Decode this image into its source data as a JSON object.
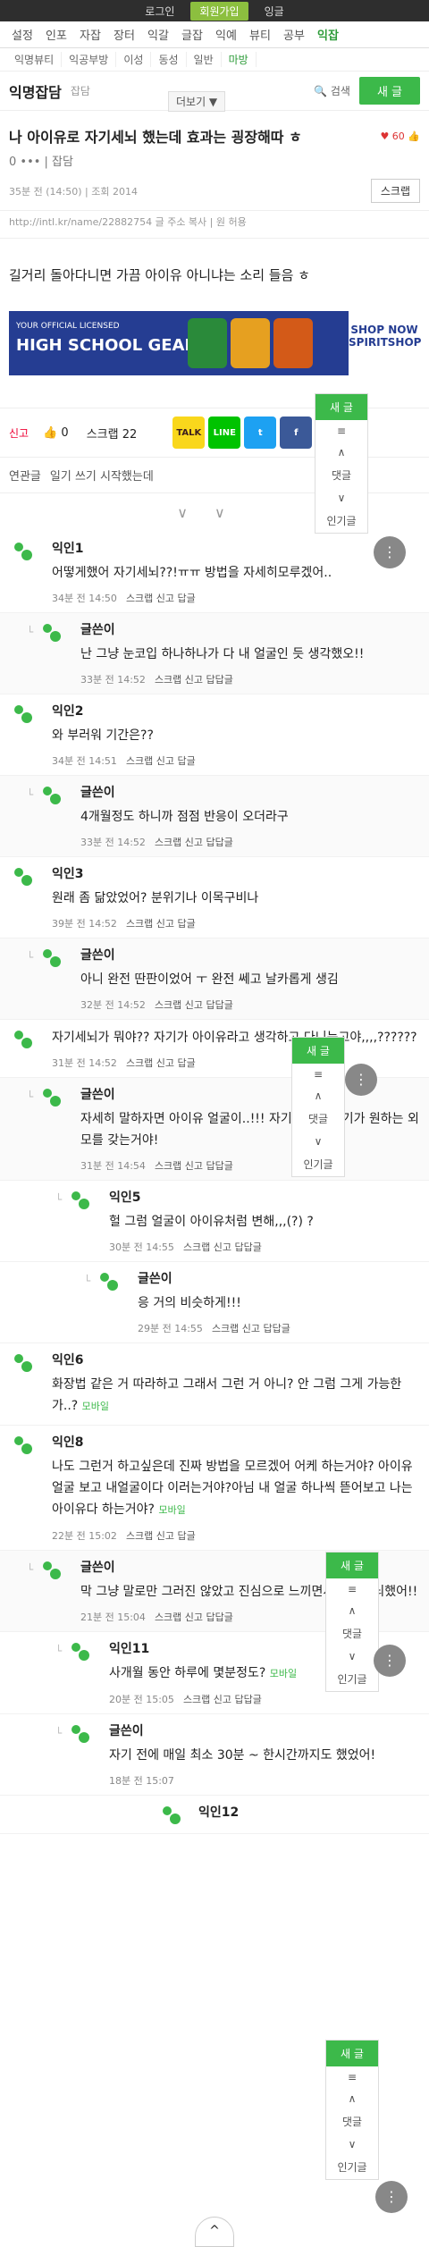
{
  "topbar": {
    "login": "로그인",
    "join": "회원가입",
    "english": "잉글"
  },
  "categories": [
    "설정",
    "인포",
    "자잡",
    "장터",
    "익갈",
    "글잡",
    "익예",
    "뷰티",
    "공부",
    "익잡"
  ],
  "subcategories": [
    "익명뷰티",
    "익공부방",
    "이성",
    "동성",
    "일반",
    "마방"
  ],
  "board": {
    "name": "익명잡담",
    "sub": "잡담",
    "more": "더보기 ▼",
    "search": "검색",
    "write": "새 글"
  },
  "post": {
    "title": "나 아이유로 자기세뇌 했는데 효과는 굉장해따 ㅎ",
    "rec_count": "60",
    "meta1": "0 ••• | 잡담",
    "meta2": "35분 전 (14:50) | 조회 2014",
    "scrap": "스크랩",
    "url": "http://intl.kr/name/22882754 글 주소 복사 | 원 허용",
    "body": "길거리 돌아다니면 가끔 아이유 아니냐는 소리 들음 ㅎ"
  },
  "ad": {
    "line1": "YOUR OFFICIAL LICENSED",
    "line2": "HIGH SCHOOL GEAR",
    "shop": "SHOP NOW SPIRITSHOP"
  },
  "actions": {
    "report": "신고",
    "like": "0",
    "scrap": "스크랩 22",
    "talk": "TALK",
    "line": "LINE",
    "twitter": "t",
    "facebook": "f"
  },
  "related": {
    "label": "연관글",
    "item": "일기 쓰기 시작했는데"
  },
  "floating": {
    "new": "새 글",
    "list": "≡",
    "up": "∧",
    "comments": "댓글",
    "down": "∨",
    "popular": "인기글"
  },
  "comments": [
    {
      "nick": "익인1",
      "text": "어떻게했어 자기세뇌??!ㅠㅠ 방법을 자세히모루겠어..",
      "meta": "34분 전 14:50",
      "links": "스크랩 신고 답글"
    },
    {
      "nick": "글쓴이",
      "text": "난 그냥 눈코입 하나하나가 다 내 얼굴인 듯 생각했오!!",
      "meta": "33분 전 14:52",
      "links": "스크랩 신고 답답글"
    },
    {
      "nick": "익인2",
      "text": "와 부러워 기간은??",
      "meta": "34분 전 14:51",
      "links": "스크랩 신고 답글"
    },
    {
      "nick": "글쓴이",
      "text": "4개월정도 하니까 점점 반응이 오더라구",
      "meta": "33분 전 14:52",
      "links": "스크랩 신고 답답글"
    },
    {
      "nick": "익인3",
      "text": "원래 좀 닮았었어? 분위기나 이목구비나",
      "meta": "39분 전 14:52",
      "links": "스크랩 신고 답글"
    },
    {
      "nick": "글쓴이",
      "text": "아니 완전 딴판이었어 ㅜ 완전 쎄고 날카롭게 생김",
      "meta": "32분 전 14:52",
      "links": "스크랩 신고 답답글"
    },
    {
      "nick": "",
      "text": "자기세뇌가 뭐야?? 자기가 아이유라고 생각하고 다니는고야,,,,??????",
      "meta": "31분 전 14:52",
      "links": "스크랩 신고 답글"
    },
    {
      "nick": "글쓴이",
      "text": "자세히 말하자면 아이유 얼굴이..!!! 자기세뇌로 자기가 원하는 외모를 갖는거야!",
      "meta": "31분 전 14:54",
      "links": "스크랩 신고 답답글"
    },
    {
      "nick": "익인5",
      "text": "헐 그럼 얼굴이 아이유처럼 변해,,,(?) ?",
      "meta": "30분 전 14:55",
      "links": "스크랩 신고 답답글"
    },
    {
      "nick": "글쓴이",
      "text": "응 거의 비슷하게!!!",
      "meta": "29분 전 14:55",
      "links": "스크랩 신고 답답글"
    },
    {
      "nick": "익인6",
      "text": "화장법 같은 거 따라하고 그래서 그런 거 아니? 안 그럼 그게 가능한가..?",
      "meta": "",
      "links": "",
      "mobile": "모바일"
    },
    {
      "nick": "익인8",
      "text": "나도 그런거 하고싶은데 진짜 방법을 모르겠어 어케 하는거야? 아이유 얼굴 보고 내얼굴이다 이러는거야?아님 내 얼굴 하나씩 뜯어보고 나는 아이유다 하는거야? ",
      "meta": "22분 전 15:02",
      "links": "스크랩 신고 답글",
      "mobile": "모바일"
    },
    {
      "nick": "글쓴이",
      "text": "막 그냥 말로만 그러진 않았고 진심으로 느끼면서 자기세뇌했어!!",
      "meta": "21분 전 15:04",
      "links": "스크랩 신고 답답글"
    },
    {
      "nick": "익인11",
      "text": "사개월 동안 하루에 몇분정도? ",
      "meta": "20분 전 15:05",
      "links": "스크랩 신고 답답글",
      "mobile": "모바일"
    },
    {
      "nick": "글쓴이",
      "text": "자기 전에 매일 최소 30분 ~ 한시간까지도 했었어!",
      "meta": "18분 전 15:07",
      "links": ""
    },
    {
      "nick": "익인12",
      "text": "",
      "meta": "",
      "links": ""
    }
  ],
  "top_button": "^"
}
